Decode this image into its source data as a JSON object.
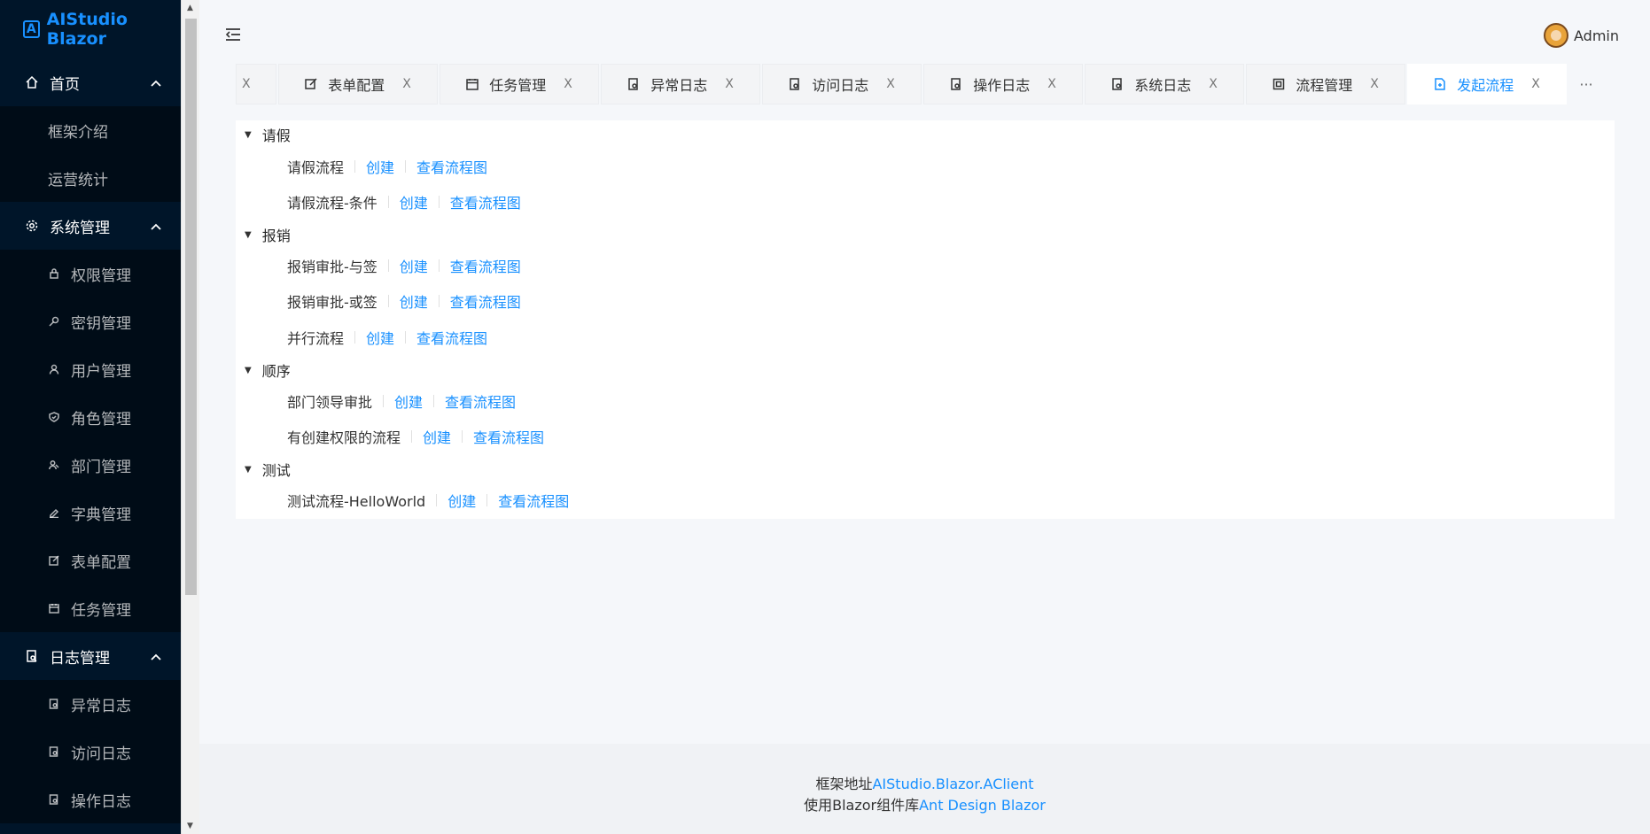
{
  "app": {
    "title": "AIStudio Blazor"
  },
  "sidebar": {
    "groups": [
      {
        "title": "首页",
        "icon": "home-icon",
        "items": [
          "框架介绍",
          "运营统计"
        ]
      },
      {
        "title": "系统管理",
        "icon": "gear-icon",
        "items": [
          "权限管理",
          "密钥管理",
          "用户管理",
          "角色管理",
          "部门管理",
          "字典管理",
          "表单配置",
          "任务管理"
        ]
      },
      {
        "title": "日志管理",
        "icon": "log-icon",
        "items": [
          "异常日志",
          "访问日志",
          "操作日志"
        ]
      }
    ]
  },
  "header": {
    "user_name": "Admin"
  },
  "tabs": [
    {
      "label": "表单配置",
      "icon": "edit-icon"
    },
    {
      "label": "任务管理",
      "icon": "calendar-icon"
    },
    {
      "label": "异常日志",
      "icon": "log-icon"
    },
    {
      "label": "访问日志",
      "icon": "log-icon"
    },
    {
      "label": "操作日志",
      "icon": "log-icon"
    },
    {
      "label": "系统日志",
      "icon": "log-icon"
    },
    {
      "label": "流程管理",
      "icon": "flow-icon"
    },
    {
      "label": "发起流程",
      "icon": "file-icon",
      "active": true
    }
  ],
  "tab_close": "X",
  "tab_more": "···",
  "actions": {
    "create": "创建",
    "view": "查看流程图"
  },
  "categories": [
    {
      "name": "请假",
      "flows": [
        "请假流程",
        "请假流程-条件"
      ]
    },
    {
      "name": "报销",
      "flows": [
        "报销审批-与签",
        "报销审批-或签",
        "并行流程"
      ]
    },
    {
      "name": "顺序",
      "flows": [
        "部门领导审批",
        "有创建权限的流程"
      ]
    },
    {
      "name": "测试",
      "flows": [
        "测试流程-HelloWorld"
      ]
    }
  ],
  "footer": {
    "line1_prefix": "框架地址",
    "line1_link": "AIStudio.Blazor.AClient",
    "line2_prefix": "使用Blazor组件库",
    "line2_link": "Ant Design Blazor"
  },
  "colors": {
    "sidebar_bg": "#001529",
    "accent": "#1890ff"
  }
}
